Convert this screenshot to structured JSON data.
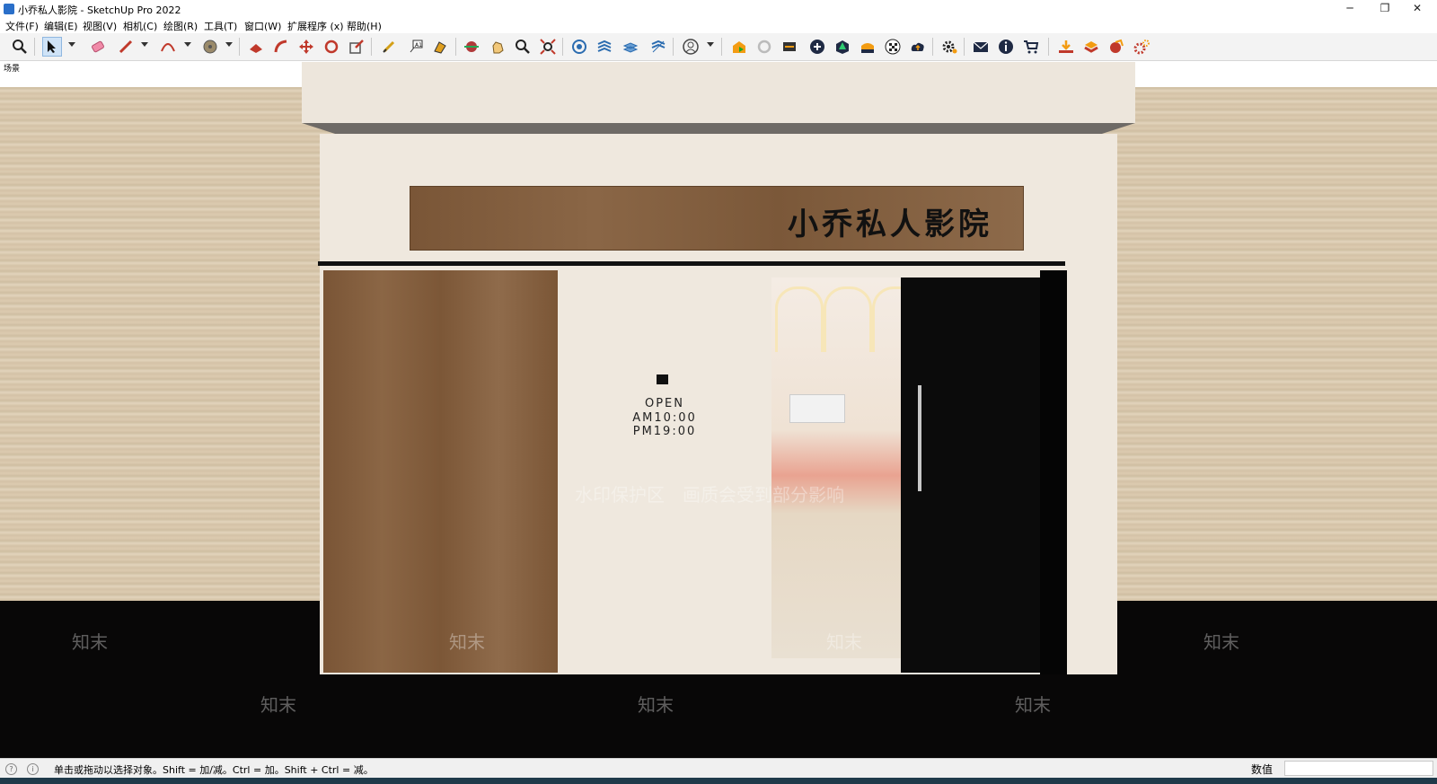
{
  "window": {
    "title": "小乔私人影院 - SketchUp Pro 2022",
    "controls": {
      "minimize": "─",
      "restore": "❐",
      "close": "✕"
    }
  },
  "menu": [
    {
      "label": "文件(F)"
    },
    {
      "label": "编辑(E)"
    },
    {
      "label": "视图(V)"
    },
    {
      "label": "相机(C)"
    },
    {
      "label": "绘图(R)"
    },
    {
      "label": "工具(T)"
    },
    {
      "label": "窗口(W)"
    },
    {
      "label": "扩展程序 (x)"
    },
    {
      "label": "帮助(H)"
    }
  ],
  "toolbar": {
    "icons": [
      "zoom-icon",
      "select-icon",
      "eraser-icon",
      "pencil-icon",
      "arc-icon",
      "paint-bucket-icon",
      "push-pull-icon",
      "follow-me-icon",
      "move-icon",
      "rotate-icon",
      "scale-icon",
      "tape-measure-icon",
      "text-icon",
      "paint-icon",
      "section-plane-icon",
      "hand-icon",
      "zoom-window-icon",
      "zoom-extents-icon",
      "component-icon",
      "layer-icon",
      "style-icon",
      "scene-icon",
      "profile-icon",
      "warehouse-icon",
      "sync-icon",
      "transfer-icon",
      "add-icon",
      "tree-icon",
      "material-icon",
      "checker-icon",
      "cloud-upload-icon",
      "settings-gear-icon",
      "mail-icon",
      "info-icon",
      "cart-icon",
      "download-icon",
      "extension-icon",
      "render-icon",
      "settings-icon"
    ]
  },
  "scene": {
    "tab_label": "场景",
    "signboard_text": "小乔私人影院",
    "open_label": "OPEN",
    "am_hours": "AM10:00",
    "pm_hours": "PM19:00"
  },
  "watermarks": {
    "banner": "水印保护区　画质会受到部分影响",
    "brand": "知末"
  },
  "status": {
    "hint": "单击或拖动以选择对象。Shift = 加/减。Ctrl = 加。Shift + Ctrl = 减。",
    "measure_label": "数值",
    "measure_value": ""
  }
}
